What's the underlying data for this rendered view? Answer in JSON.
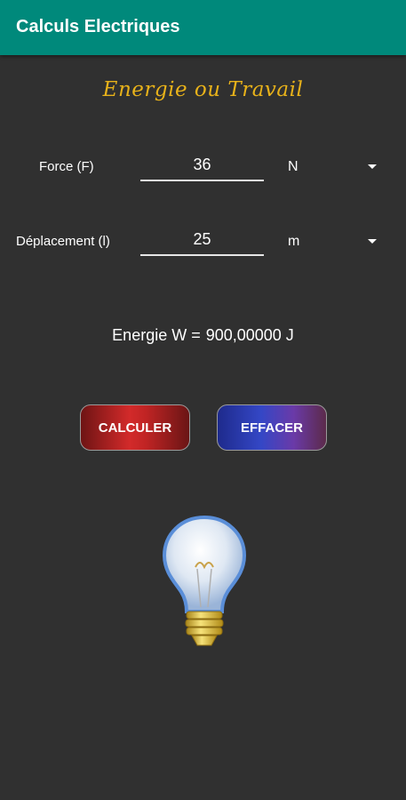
{
  "appbar": {
    "title": "Calculs Electriques"
  },
  "heading": "Energie ou Travail",
  "rows": [
    {
      "label": "Force (F)",
      "value": "36",
      "unit": "N"
    },
    {
      "label": "Déplacement (l)",
      "value": "25",
      "unit": "m"
    }
  ],
  "result": {
    "label": "Energie W =",
    "value": "900,00000 J"
  },
  "buttons": {
    "calculate": "CALCULER",
    "clear": "EFFACER"
  },
  "icons": {
    "dropdown": "triangle-down-icon",
    "bulb": "light-bulb-icon"
  },
  "colors": {
    "appbar": "#00897b",
    "heading": "#e8b21a",
    "background": "#303030"
  }
}
